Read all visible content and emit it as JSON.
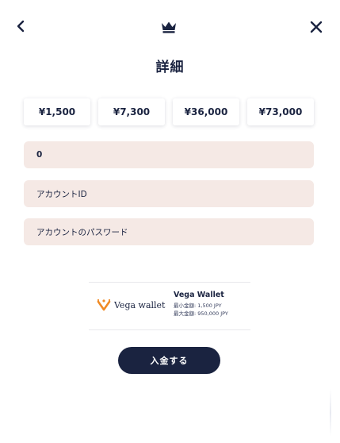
{
  "header": {
    "title": "詳細",
    "back_icon": "chevron-left-icon",
    "logo_icon": "crown-icon",
    "close_icon": "close-icon"
  },
  "amount_options": [
    {
      "label": "¥1,500"
    },
    {
      "label": "¥7,300"
    },
    {
      "label": "¥36,000"
    },
    {
      "label": "¥73,000"
    }
  ],
  "form": {
    "amount_value": "0",
    "account_id_placeholder": "アカウントID",
    "account_password_placeholder": "アカウントのパスワード"
  },
  "payment_method": {
    "logo_text": "Vega wallet",
    "name": "Vega Wallet",
    "min_deposit": "最小金額: 1,500 JPY",
    "max_deposit": "最大金額: 950,000 JPY"
  },
  "submit_label": "入金する",
  "colors": {
    "primary": "#1a2340",
    "field_background": "#f5e9e5",
    "logo_orange": "#f08a24"
  }
}
